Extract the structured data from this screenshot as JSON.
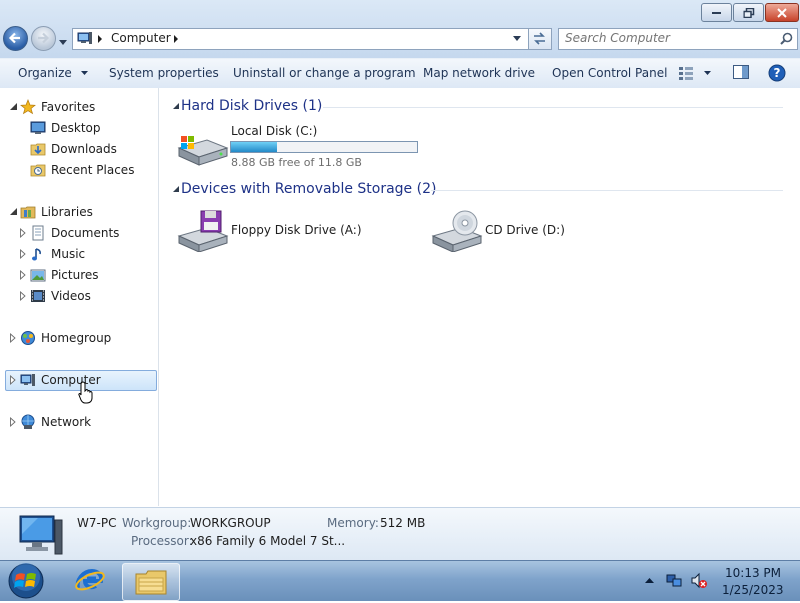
{
  "window": {
    "address_path": "Computer",
    "search_placeholder": "Search Computer",
    "caption_buttons": [
      "minimize-icon",
      "restore-icon",
      "close-icon"
    ]
  },
  "command_bar": {
    "organize": "Organize",
    "system_properties": "System properties",
    "uninstall": "Uninstall or change a program",
    "map_network_drive": "Map network drive",
    "open_control_panel": "Open Control Panel"
  },
  "nav": {
    "favorites": {
      "label": "Favorites",
      "items": [
        "Desktop",
        "Downloads",
        "Recent Places"
      ]
    },
    "libraries": {
      "label": "Libraries",
      "items": [
        "Documents",
        "Music",
        "Pictures",
        "Videos"
      ]
    },
    "homegroup": "Homegroup",
    "computer": "Computer",
    "network": "Network"
  },
  "content": {
    "hard_disk_header": "Hard Disk Drives (1)",
    "removable_header": "Devices with Removable Storage (2)",
    "local_disk": {
      "label": "Local Disk (C:)",
      "free_text": "8.88 GB free of 11.8 GB",
      "used_fraction": 0.247
    },
    "floppy": "Floppy Disk Drive (A:)",
    "cd": "CD Drive (D:)"
  },
  "details": {
    "pc_name": "W7-PC",
    "workgroup_key": "Workgroup:",
    "workgroup_val": "WORKGROUP",
    "memory_key": "Memory:",
    "memory_val": "512 MB",
    "processor_key": "Processor:",
    "processor_val": "x86 Family 6 Model 7 St..."
  },
  "taskbar": {
    "time": "10:13 PM",
    "date": "1/25/2023"
  },
  "colors": {
    "accent": "#1e3287",
    "progress": "#2389c8",
    "selection": "#cde4fa"
  }
}
